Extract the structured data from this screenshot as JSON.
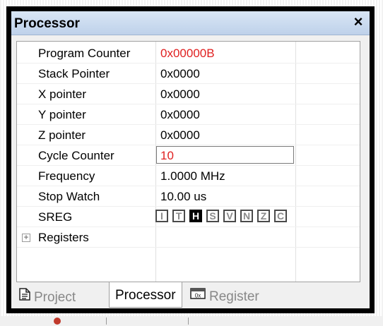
{
  "window": {
    "title": "Processor",
    "close_glyph": "×"
  },
  "rows": [
    {
      "name": "Program Counter",
      "value": "0x00000B"
    },
    {
      "name": "Stack Pointer",
      "value": "0x0000"
    },
    {
      "name": "X pointer",
      "value": "0x0000"
    },
    {
      "name": "Y pointer",
      "value": "0x0000"
    },
    {
      "name": "Z pointer",
      "value": "0x0000"
    },
    {
      "name": "Cycle Counter",
      "value": "10"
    },
    {
      "name": "Frequency",
      "value": "1.0000 MHz"
    },
    {
      "name": "Stop Watch",
      "value": "10.00 us"
    },
    {
      "name": "SREG"
    },
    {
      "name": "Registers"
    }
  ],
  "sreg_flags": [
    {
      "letter": "I",
      "set": false
    },
    {
      "letter": "T",
      "set": false
    },
    {
      "letter": "H",
      "set": true
    },
    {
      "letter": "S",
      "set": false
    },
    {
      "letter": "V",
      "set": false
    },
    {
      "letter": "N",
      "set": false
    },
    {
      "letter": "Z",
      "set": false
    },
    {
      "letter": "C",
      "set": false
    }
  ],
  "expand_glyph": "+",
  "tabs": [
    {
      "label": "Project",
      "icon": "document-icon",
      "active": false
    },
    {
      "label": "Processor",
      "active": true
    },
    {
      "label": "Register",
      "icon": "register-icon",
      "active": false
    }
  ],
  "colors": {
    "changed_value": "#e02020",
    "title_gradient_top": "#d9e6f5",
    "title_gradient_bottom": "#bed1ea"
  }
}
